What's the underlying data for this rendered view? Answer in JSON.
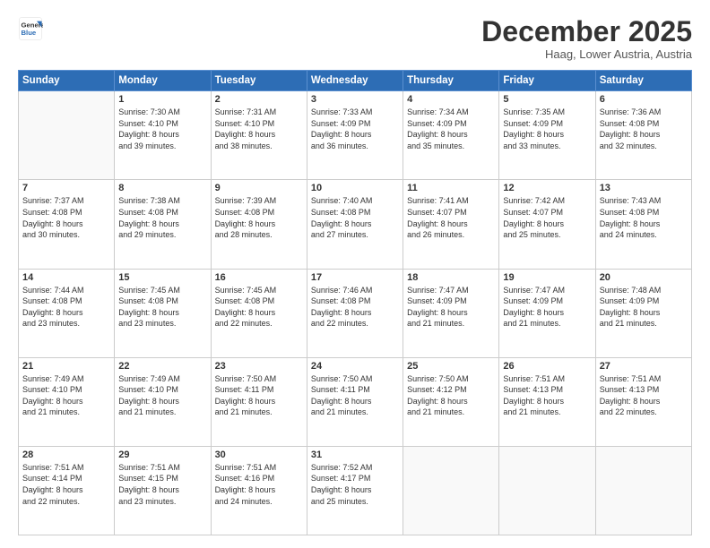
{
  "header": {
    "logo_line1": "General",
    "logo_line2": "Blue",
    "month": "December 2025",
    "location": "Haag, Lower Austria, Austria"
  },
  "weekdays": [
    "Sunday",
    "Monday",
    "Tuesday",
    "Wednesday",
    "Thursday",
    "Friday",
    "Saturday"
  ],
  "weeks": [
    [
      {
        "day": "",
        "info": ""
      },
      {
        "day": "1",
        "info": "Sunrise: 7:30 AM\nSunset: 4:10 PM\nDaylight: 8 hours\nand 39 minutes."
      },
      {
        "day": "2",
        "info": "Sunrise: 7:31 AM\nSunset: 4:10 PM\nDaylight: 8 hours\nand 38 minutes."
      },
      {
        "day": "3",
        "info": "Sunrise: 7:33 AM\nSunset: 4:09 PM\nDaylight: 8 hours\nand 36 minutes."
      },
      {
        "day": "4",
        "info": "Sunrise: 7:34 AM\nSunset: 4:09 PM\nDaylight: 8 hours\nand 35 minutes."
      },
      {
        "day": "5",
        "info": "Sunrise: 7:35 AM\nSunset: 4:09 PM\nDaylight: 8 hours\nand 33 minutes."
      },
      {
        "day": "6",
        "info": "Sunrise: 7:36 AM\nSunset: 4:08 PM\nDaylight: 8 hours\nand 32 minutes."
      }
    ],
    [
      {
        "day": "7",
        "info": "Sunrise: 7:37 AM\nSunset: 4:08 PM\nDaylight: 8 hours\nand 30 minutes."
      },
      {
        "day": "8",
        "info": "Sunrise: 7:38 AM\nSunset: 4:08 PM\nDaylight: 8 hours\nand 29 minutes."
      },
      {
        "day": "9",
        "info": "Sunrise: 7:39 AM\nSunset: 4:08 PM\nDaylight: 8 hours\nand 28 minutes."
      },
      {
        "day": "10",
        "info": "Sunrise: 7:40 AM\nSunset: 4:08 PM\nDaylight: 8 hours\nand 27 minutes."
      },
      {
        "day": "11",
        "info": "Sunrise: 7:41 AM\nSunset: 4:07 PM\nDaylight: 8 hours\nand 26 minutes."
      },
      {
        "day": "12",
        "info": "Sunrise: 7:42 AM\nSunset: 4:07 PM\nDaylight: 8 hours\nand 25 minutes."
      },
      {
        "day": "13",
        "info": "Sunrise: 7:43 AM\nSunset: 4:08 PM\nDaylight: 8 hours\nand 24 minutes."
      }
    ],
    [
      {
        "day": "14",
        "info": "Sunrise: 7:44 AM\nSunset: 4:08 PM\nDaylight: 8 hours\nand 23 minutes."
      },
      {
        "day": "15",
        "info": "Sunrise: 7:45 AM\nSunset: 4:08 PM\nDaylight: 8 hours\nand 23 minutes."
      },
      {
        "day": "16",
        "info": "Sunrise: 7:45 AM\nSunset: 4:08 PM\nDaylight: 8 hours\nand 22 minutes."
      },
      {
        "day": "17",
        "info": "Sunrise: 7:46 AM\nSunset: 4:08 PM\nDaylight: 8 hours\nand 22 minutes."
      },
      {
        "day": "18",
        "info": "Sunrise: 7:47 AM\nSunset: 4:09 PM\nDaylight: 8 hours\nand 21 minutes."
      },
      {
        "day": "19",
        "info": "Sunrise: 7:47 AM\nSunset: 4:09 PM\nDaylight: 8 hours\nand 21 minutes."
      },
      {
        "day": "20",
        "info": "Sunrise: 7:48 AM\nSunset: 4:09 PM\nDaylight: 8 hours\nand 21 minutes."
      }
    ],
    [
      {
        "day": "21",
        "info": "Sunrise: 7:49 AM\nSunset: 4:10 PM\nDaylight: 8 hours\nand 21 minutes."
      },
      {
        "day": "22",
        "info": "Sunrise: 7:49 AM\nSunset: 4:10 PM\nDaylight: 8 hours\nand 21 minutes."
      },
      {
        "day": "23",
        "info": "Sunrise: 7:50 AM\nSunset: 4:11 PM\nDaylight: 8 hours\nand 21 minutes."
      },
      {
        "day": "24",
        "info": "Sunrise: 7:50 AM\nSunset: 4:11 PM\nDaylight: 8 hours\nand 21 minutes."
      },
      {
        "day": "25",
        "info": "Sunrise: 7:50 AM\nSunset: 4:12 PM\nDaylight: 8 hours\nand 21 minutes."
      },
      {
        "day": "26",
        "info": "Sunrise: 7:51 AM\nSunset: 4:13 PM\nDaylight: 8 hours\nand 21 minutes."
      },
      {
        "day": "27",
        "info": "Sunrise: 7:51 AM\nSunset: 4:13 PM\nDaylight: 8 hours\nand 22 minutes."
      }
    ],
    [
      {
        "day": "28",
        "info": "Sunrise: 7:51 AM\nSunset: 4:14 PM\nDaylight: 8 hours\nand 22 minutes."
      },
      {
        "day": "29",
        "info": "Sunrise: 7:51 AM\nSunset: 4:15 PM\nDaylight: 8 hours\nand 23 minutes."
      },
      {
        "day": "30",
        "info": "Sunrise: 7:51 AM\nSunset: 4:16 PM\nDaylight: 8 hours\nand 24 minutes."
      },
      {
        "day": "31",
        "info": "Sunrise: 7:52 AM\nSunset: 4:17 PM\nDaylight: 8 hours\nand 25 minutes."
      },
      {
        "day": "",
        "info": ""
      },
      {
        "day": "",
        "info": ""
      },
      {
        "day": "",
        "info": ""
      }
    ]
  ]
}
